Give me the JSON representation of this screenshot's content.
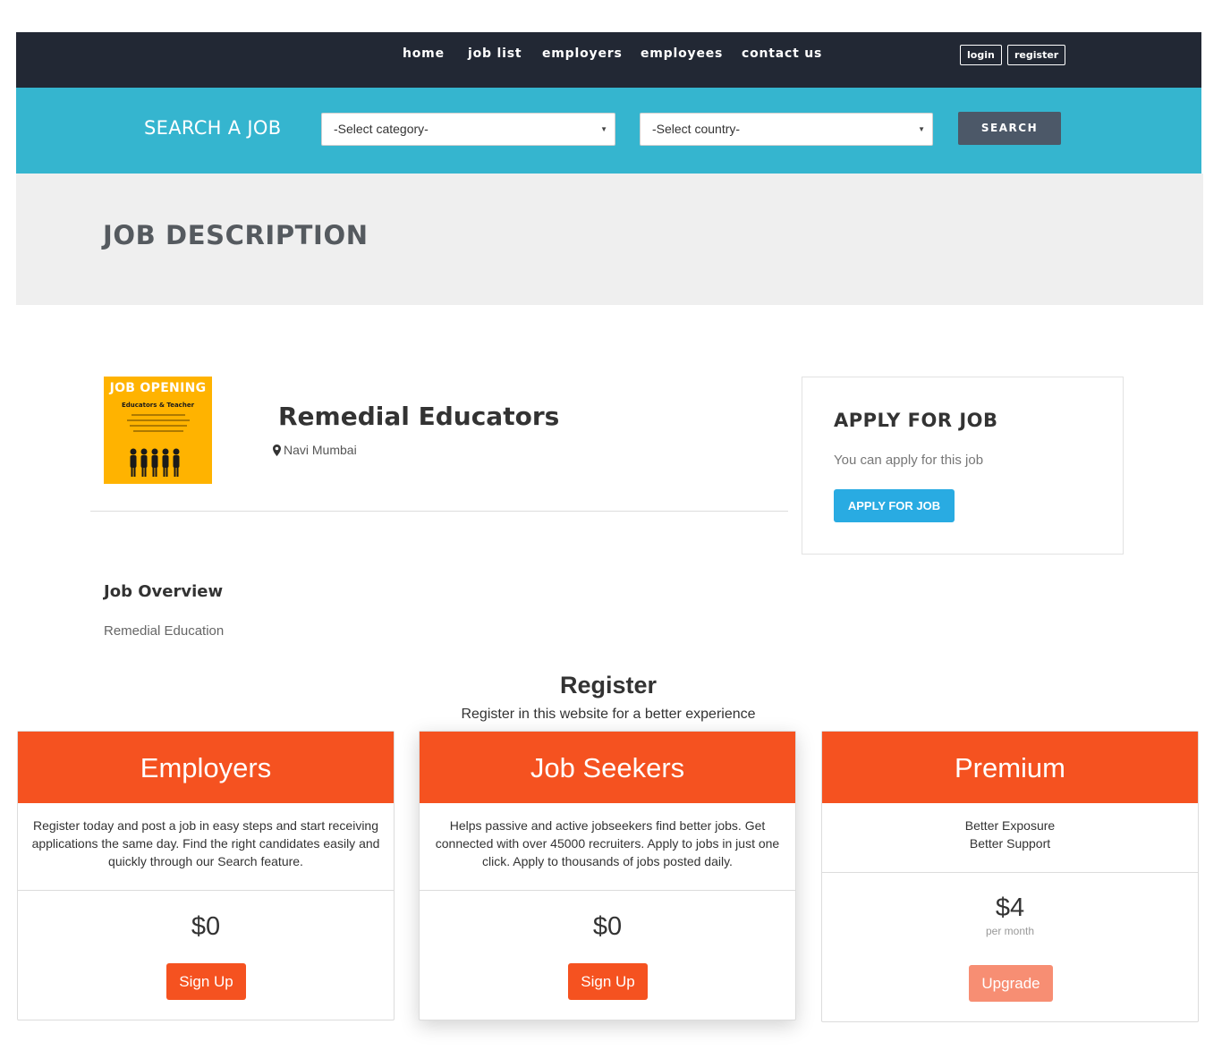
{
  "nav": {
    "links": [
      "home",
      "job list",
      "employers",
      "employees",
      "contact us"
    ],
    "login": "login",
    "register": "register"
  },
  "search": {
    "title": "SEARCH A JOB",
    "category": "-Select category-",
    "country": "-Select country-",
    "button": "SEARCH"
  },
  "page": {
    "title": "JOB DESCRIPTION"
  },
  "job": {
    "logo_title": "JOB OPENING",
    "logo_sub": "Educators & Teacher",
    "title": "Remedial Educators",
    "location": "Navi Mumbai",
    "overview_heading": "Job Overview",
    "overview_text": "Remedial Education"
  },
  "apply": {
    "title": "APPLY FOR JOB",
    "text": "You can apply for this job",
    "button": "APPLY FOR JOB"
  },
  "register": {
    "title": "Register",
    "subtitle": "Register in this website for a better experience",
    "plans": [
      {
        "name": "Employers",
        "desc": "Register today and post a job in easy steps and start receiving applications the same day. Find the right candidates easily and quickly through our Search feature.",
        "price": "$0",
        "per": "",
        "button": "Sign Up"
      },
      {
        "name": "Job Seekers",
        "desc": "Helps passive and active jobseekers find better jobs. Get connected with over 45000 recruiters. Apply to jobs in just one click. Apply to thousands of jobs posted daily.",
        "price": "$0",
        "per": "",
        "button": "Sign Up"
      },
      {
        "name": "Premium",
        "desc_lines": [
          "Better Exposure",
          "Better Support"
        ],
        "price": "$4",
        "per": "per month",
        "button": "Upgrade"
      }
    ]
  },
  "colors": {
    "nav_bg": "#222834",
    "search_bg": "#35b5cf",
    "accent_orange": "#f55220",
    "apply_blue": "#29abe2"
  }
}
